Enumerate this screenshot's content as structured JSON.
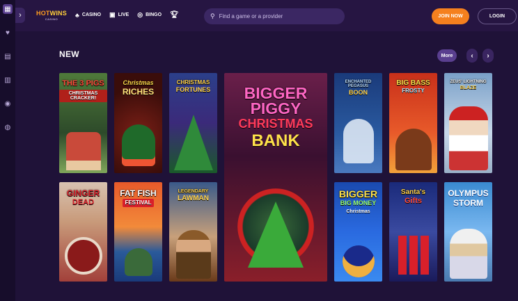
{
  "logo": {
    "brand_hot": "HOT",
    "brand_wins": "WINS",
    "sub": "CASINO"
  },
  "nav": {
    "items": [
      {
        "label": "CASINO",
        "icon": "spade-icon"
      },
      {
        "label": "LIVE",
        "icon": "live-icon"
      },
      {
        "label": "BINGO",
        "icon": "bingo-icon"
      }
    ],
    "trophy_icon": "trophy-icon"
  },
  "search": {
    "placeholder": "Find a game or a provider"
  },
  "auth": {
    "join": "JOIN NOW",
    "login": "LOGIN"
  },
  "section": {
    "title": "NEW",
    "more": "More"
  },
  "sidebar": {
    "icons": [
      "grid-icon",
      "heart-icon",
      "trophy-icon",
      "gift-icon",
      "coin-icon",
      "chip-icon"
    ]
  },
  "colors": {
    "bg": "#1f1238",
    "topbar": "#261542",
    "accent": "#f5801e",
    "more": "#5a3f8f"
  },
  "games": [
    {
      "t": "THE 3 PIGS",
      "s": "CHRISTMAS CRACKER!"
    },
    {
      "t": "Christmas",
      "s": "RICHES"
    },
    {
      "t": "CHRISTMAS",
      "s": "FORTUNES"
    },
    {
      "t": "BIGGER PIGGY",
      "s": "CHRISTMAS",
      "s2": "BANK"
    },
    {
      "t": "ENCHANTED PEGASUS",
      "s": "BOON"
    },
    {
      "t": "BIG BASS",
      "s": "FROSTY"
    },
    {
      "t": "ZEUS' LIGHTNING",
      "s": "BLAZE"
    },
    {
      "t": "GINGER",
      "s": "DEAD"
    },
    {
      "t": "FAT FISH",
      "s": "FESTIVAL"
    },
    {
      "t": "LEGENDARY",
      "s": "LAWMAN"
    },
    {
      "t": "BIGGER",
      "s": "BIG MONEY",
      "s2": "Christmas"
    },
    {
      "t": "Santa's",
      "s": "Gifts"
    },
    {
      "t": "OLYMPUS",
      "s": "STORM"
    }
  ]
}
